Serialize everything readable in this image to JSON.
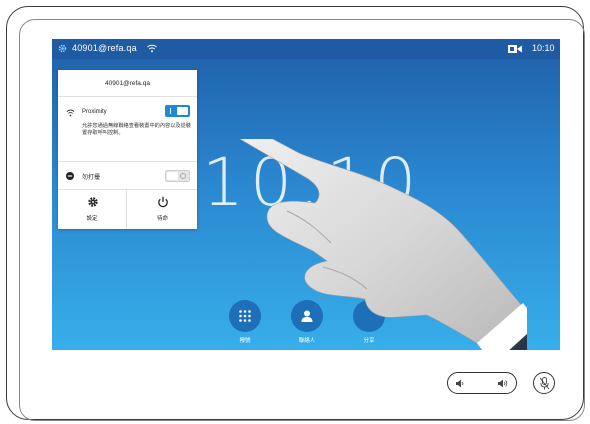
{
  "statusbar": {
    "host": "40901@refa.qa",
    "time": "10:10"
  },
  "clock_display": "10:10",
  "panel": {
    "header": "40901@refa.qa",
    "proximity_label": "Proximity",
    "proximity_on": true,
    "proximity_description": "允許您通過無線聯絡查看裝置中的內容以及從裝置存取呼叫控制。",
    "dnd_label": "勿打擾",
    "dnd_on": false,
    "settings_label": "設定",
    "standby_label": "待命"
  },
  "dock": {
    "keypad_label": "撥號",
    "contacts_label": "聯絡人",
    "share_label": "分享"
  },
  "icons": {
    "gear": "gear-icon",
    "wifi": "wifi-icon",
    "camera": "camera-icon",
    "dnd": "minus-circle-icon",
    "power": "power-icon",
    "keypad": "keypad-icon",
    "person": "person-icon",
    "volume_down": "volume-down-icon",
    "volume_up": "volume-up-icon",
    "mic_mute": "mic-mute-icon"
  },
  "colors": {
    "statusbar": "#1e5ba3",
    "accent": "#1c8ad6",
    "dock_button": "#1d6fb8"
  }
}
